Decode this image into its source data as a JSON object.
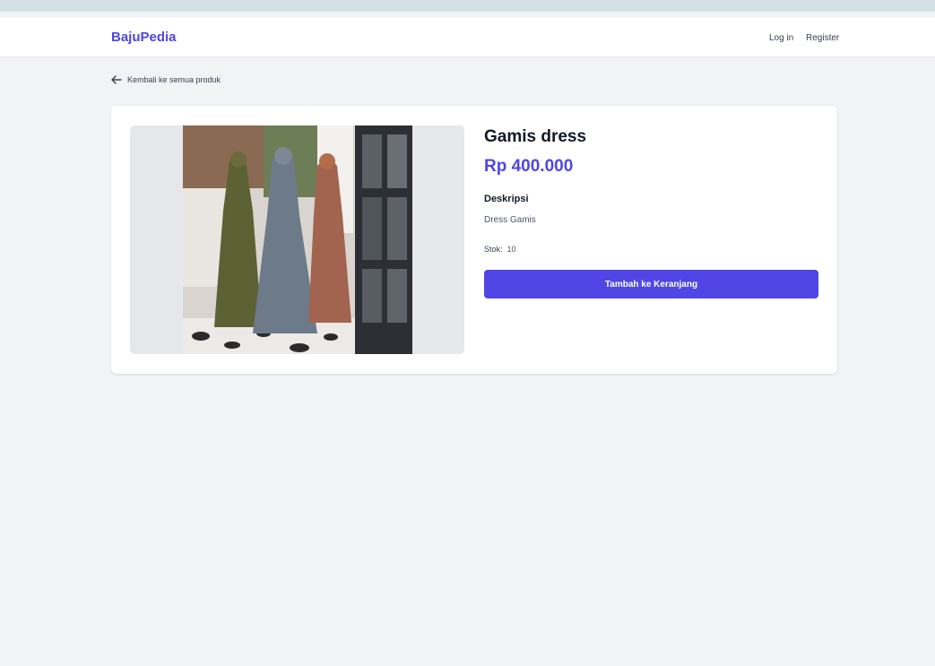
{
  "brand": "BajuPedia",
  "nav": {
    "login": "Log in",
    "register": "Register"
  },
  "back_link": {
    "label": "Kembali ke semua produk",
    "icon": "arrow-left-icon"
  },
  "product": {
    "title": "Gamis dress",
    "price": "Rp 400.000",
    "description_heading": "Deskripsi",
    "description": "Dress Gamis",
    "stock_label": "Stok:",
    "stock_value": "10",
    "add_to_cart": "Tambah ke Keranjang"
  },
  "colors": {
    "accent": "#4f46e5",
    "background": "#f2f3f5"
  }
}
